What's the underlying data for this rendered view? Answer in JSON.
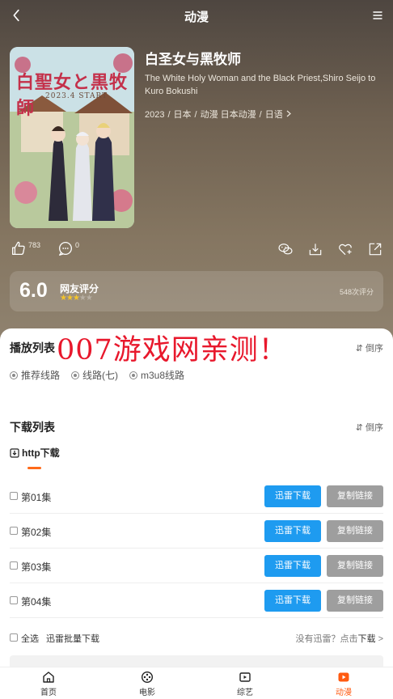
{
  "topbar": {
    "title": "动漫"
  },
  "poster": {
    "logo": "白聖女と黒牧師",
    "sub": "2023.4 START"
  },
  "anime": {
    "title": "白圣女与黑牧师",
    "english_title": "The White Holy Woman and the Black Priest,Shiro Seijo to Kuro Bokushi",
    "meta": {
      "year": "2023",
      "region": "日本",
      "category": "动漫 日本动漫",
      "language": "日语"
    }
  },
  "actions": {
    "like_count": "783",
    "comment_count": "0"
  },
  "rating": {
    "score": "6.0",
    "label": "网友评分",
    "stars_filled": 3,
    "stars_total": 5,
    "count": "548次评分"
  },
  "playlist": {
    "title": "播放列表",
    "sort": "倒序",
    "lines": [
      "推荐线路",
      "线路(七)",
      "m3u8线路"
    ]
  },
  "watermark": "007游戏网亲测！",
  "download": {
    "title": "下载列表",
    "sort": "倒序",
    "tab": "http下载",
    "episodes": [
      {
        "name": "第01集"
      },
      {
        "name": "第02集"
      },
      {
        "name": "第03集"
      },
      {
        "name": "第04集"
      }
    ],
    "xunlei_button": "迅雷下载",
    "copy_button": "复制链接",
    "select_all": "全选",
    "bulk_download": "迅雷批量下载",
    "no_xunlei_prefix": "没有迅雷？点击",
    "no_xunlei_link": "下载",
    "no_xunlei_arrow": ">"
  },
  "nav": [
    {
      "label": "首页",
      "icon": "home-icon"
    },
    {
      "label": "电影",
      "icon": "film-reel-icon"
    },
    {
      "label": "综艺",
      "icon": "tv-icon"
    },
    {
      "label": "动漫",
      "icon": "play-icon"
    }
  ],
  "colors": {
    "accent": "#ff5a10",
    "xunlei_blue": "#1e9bf0",
    "copy_gray": "#9e9e9e",
    "watermark_red": "#e8182c",
    "star": "#f5c52a"
  }
}
